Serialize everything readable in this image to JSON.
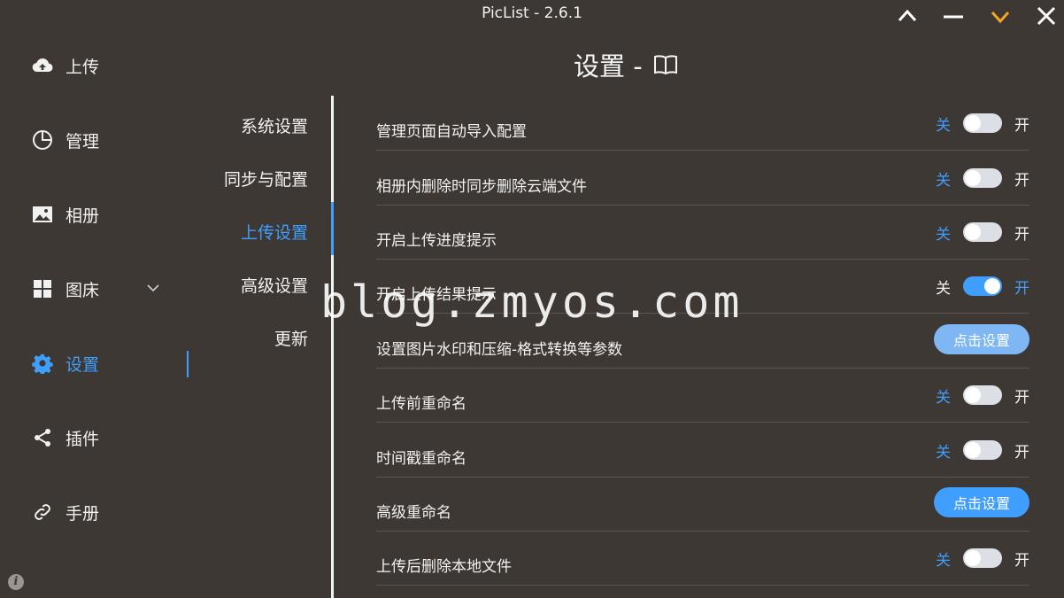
{
  "app": {
    "title": "PicList - 2.6.1"
  },
  "sidebar": {
    "items": [
      {
        "label": "上传",
        "icon": "cloud-upload-icon"
      },
      {
        "label": "管理",
        "icon": "pie-chart-icon"
      },
      {
        "label": "相册",
        "icon": "picture-icon"
      },
      {
        "label": "图床",
        "icon": "grid-icon"
      },
      {
        "label": "设置",
        "icon": "gear-icon"
      },
      {
        "label": "插件",
        "icon": "share-icon"
      },
      {
        "label": "手册",
        "icon": "link-icon"
      }
    ],
    "active": "设置"
  },
  "subnav": {
    "items": [
      "系统设置",
      "同步与配置",
      "上传设置",
      "高级设置",
      "更新"
    ],
    "active": "上传设置"
  },
  "page": {
    "title": "设置 -"
  },
  "settings": {
    "off": "关",
    "on": "开",
    "rows": [
      {
        "label": "管理页面自动导入配置",
        "type": "switch",
        "value": false
      },
      {
        "label": "相册内删除时同步删除云端文件",
        "type": "switch",
        "value": false
      },
      {
        "label": "开启上传进度提示",
        "type": "switch",
        "value": false
      },
      {
        "label": "开启上传结果提示",
        "type": "switch",
        "value": true
      },
      {
        "label": "设置图片水印和压缩-格式转换等参数",
        "type": "button",
        "button": "点击设置"
      },
      {
        "label": "上传前重命名",
        "type": "switch",
        "value": false
      },
      {
        "label": "时间戳重命名",
        "type": "switch",
        "value": false
      },
      {
        "label": "高级重命名",
        "type": "button",
        "button": "点击设置"
      },
      {
        "label": "上传后删除本地文件",
        "type": "switch",
        "value": false
      }
    ]
  },
  "watermark": "blog.zmyos.com",
  "colors": {
    "accent": "#409eff",
    "background": "#3d3833",
    "switch_off": "#dcdfe6"
  }
}
